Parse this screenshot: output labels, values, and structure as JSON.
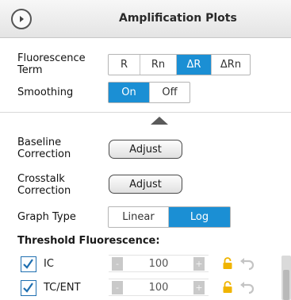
{
  "header": {
    "title": "Amplification Plots"
  },
  "fluorescence_term": {
    "label": "Fluorescence Term",
    "options": [
      "R",
      "Rn",
      "ΔR",
      "ΔRn"
    ],
    "selected": "ΔR"
  },
  "smoothing": {
    "label": "Smoothing",
    "options": [
      "On",
      "Off"
    ],
    "selected": "On"
  },
  "baseline_correction": {
    "label": "Baseline Correction",
    "button": "Adjust"
  },
  "crosstalk_correction": {
    "label": "Crosstalk Correction",
    "button": "Adjust"
  },
  "graph_type": {
    "label": "Graph Type",
    "options": [
      "Linear",
      "Log"
    ],
    "selected": "Log"
  },
  "threshold": {
    "title": "Threshold Fluorescence:",
    "rows": [
      {
        "label": "IC",
        "checked": true,
        "value": "100",
        "minus": "-",
        "plus": "+"
      },
      {
        "label": "TC/ENT",
        "checked": true,
        "value": "100",
        "minus": "-",
        "plus": "+"
      }
    ]
  },
  "colors": {
    "accent": "#1b8fd4",
    "lock": "#f0b400",
    "checkbox": "#1f6fb0"
  }
}
